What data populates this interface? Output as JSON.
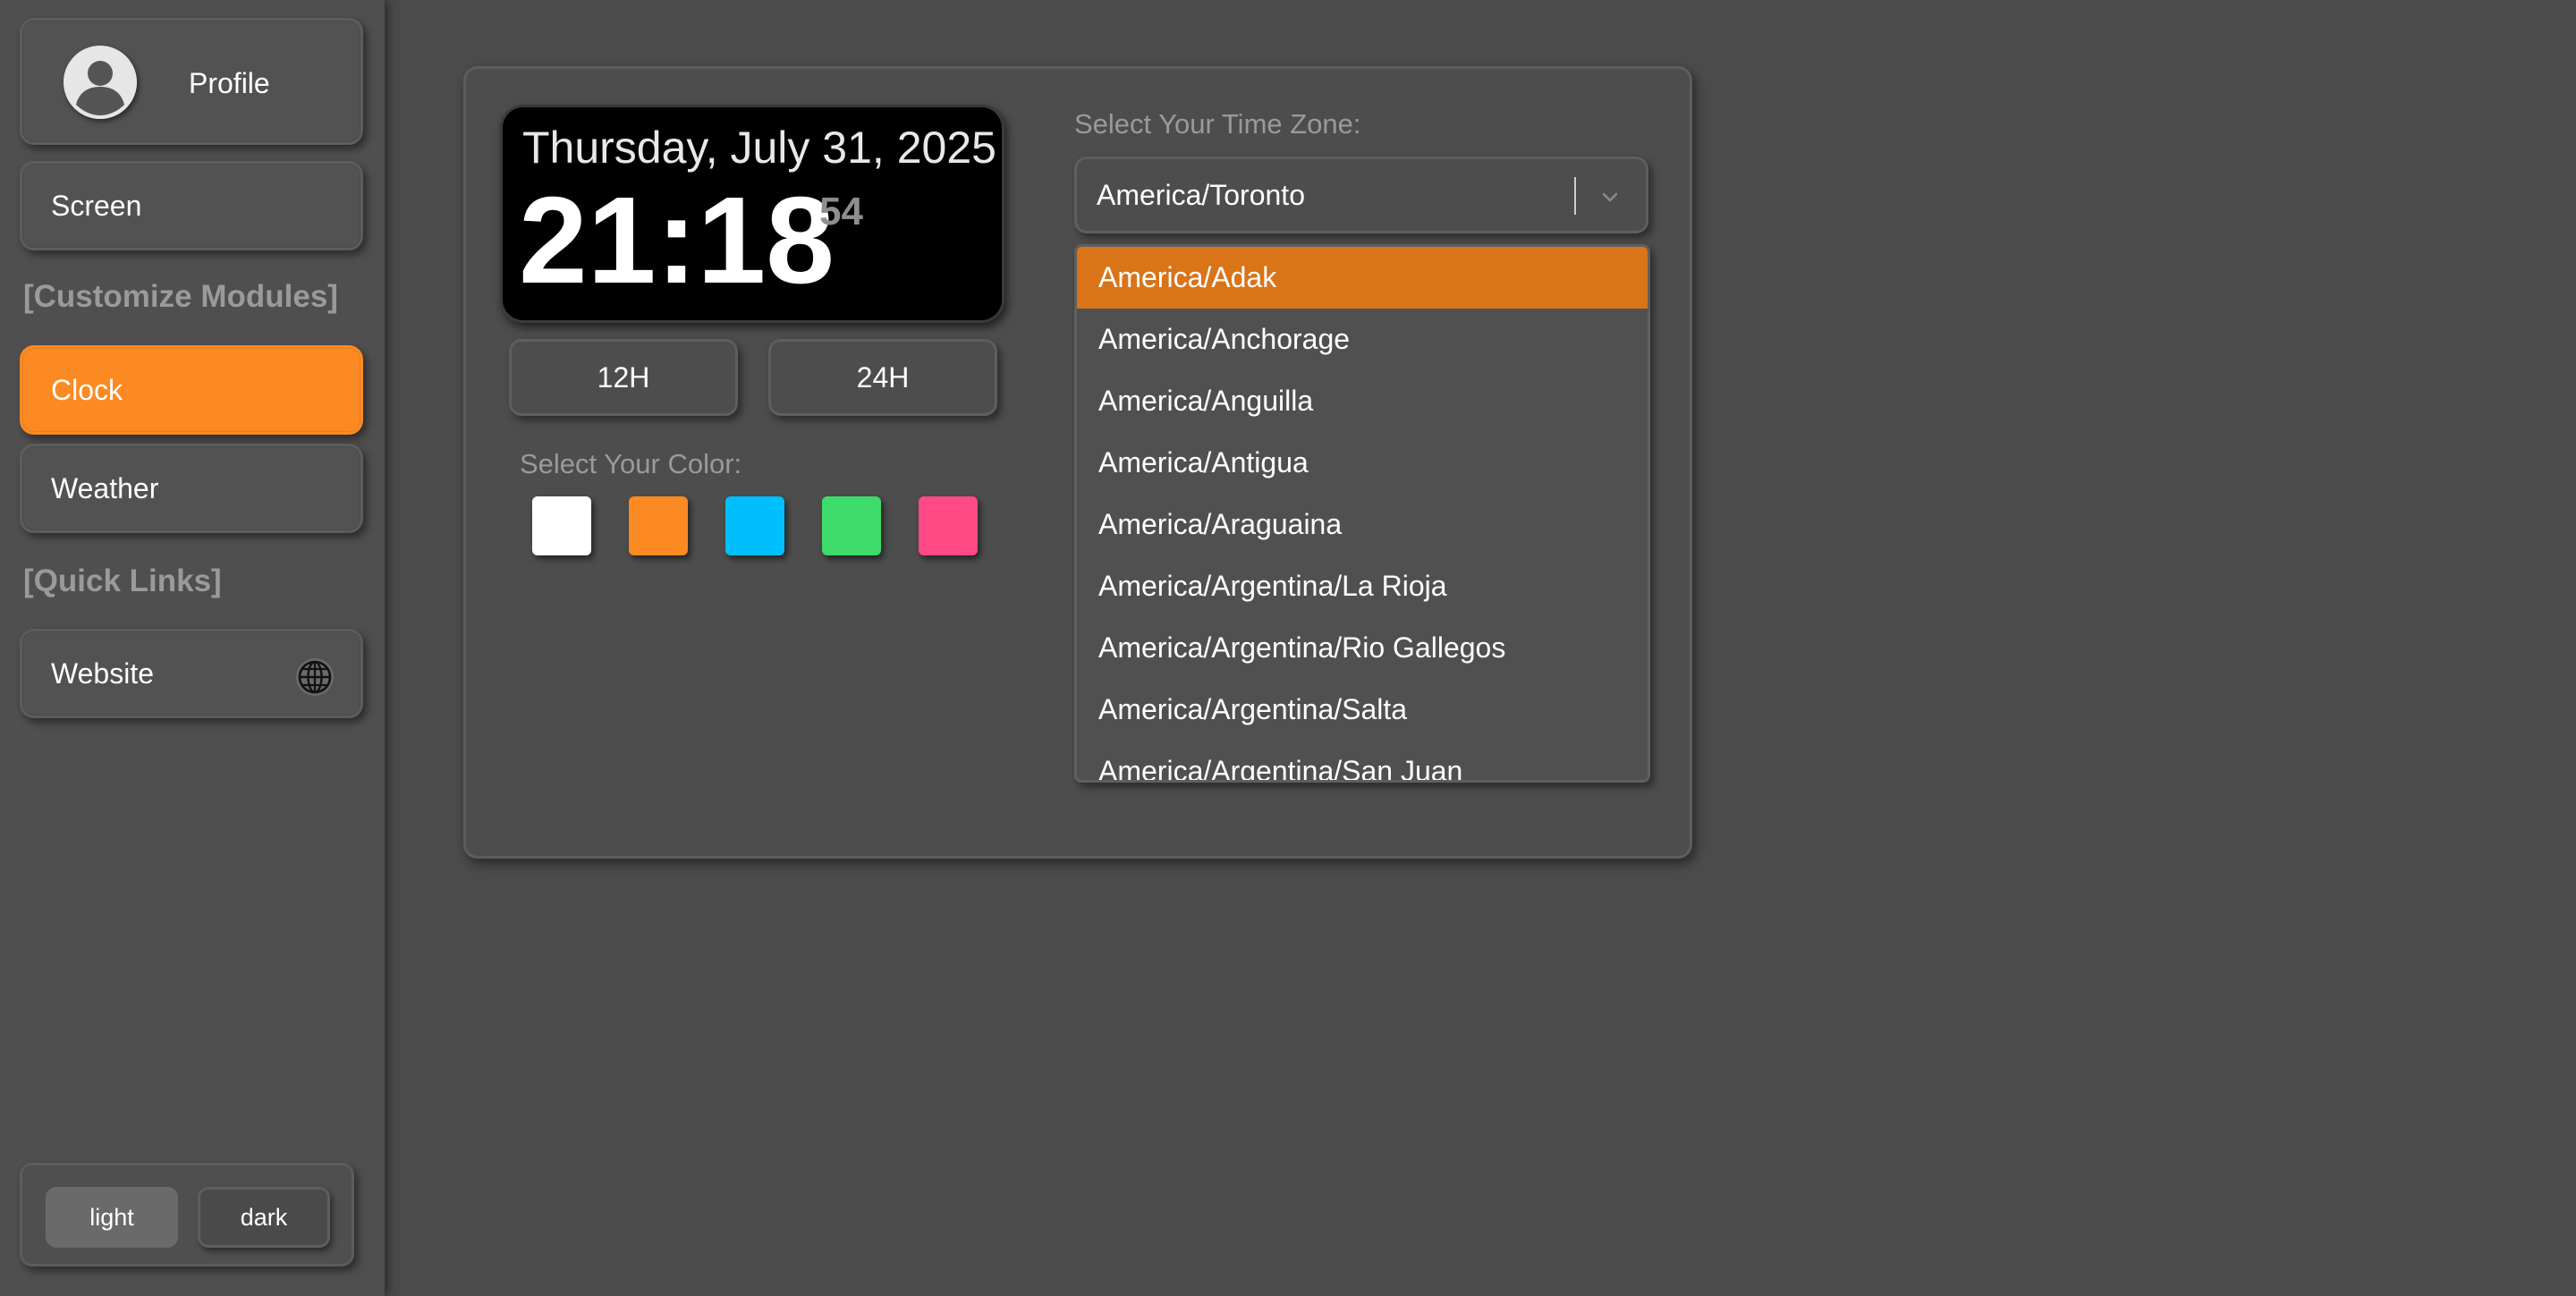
{
  "sidebar": {
    "profile_label": "Profile",
    "screen_label": "Screen",
    "customize_title": "[Customize Modules]",
    "clock_label": "Clock",
    "weather_label": "Weather",
    "links_title": "[Quick Links]",
    "website_label": "Website",
    "theme": {
      "light_label": "light",
      "dark_label": "dark"
    },
    "icons": {
      "avatar": "user-avatar-icon",
      "website": "globe-icon"
    },
    "active_color": "#fb8a22"
  },
  "clock": {
    "date": "Thursday, July 31, 2025",
    "time": "21:18",
    "seconds": "54",
    "format_12_label": "12H",
    "format_24_label": "24H",
    "color_label": "Select Your Color:",
    "colors": [
      "#ffffff",
      "#fb8a22",
      "#00bfff",
      "#3ddc6a",
      "#ff4a86"
    ]
  },
  "timezone": {
    "label": "Select Your Time Zone:",
    "selected": "America/Toronto",
    "options": [
      "America/Adak",
      "America/Anchorage",
      "America/Anguilla",
      "America/Antigua",
      "America/Araguaina",
      "America/Argentina/La Rioja",
      "America/Argentina/Rio Gallegos",
      "America/Argentina/Salta",
      "America/Argentina/San Juan"
    ],
    "highlighted_index": 0,
    "highlight_color": "#d97418"
  }
}
